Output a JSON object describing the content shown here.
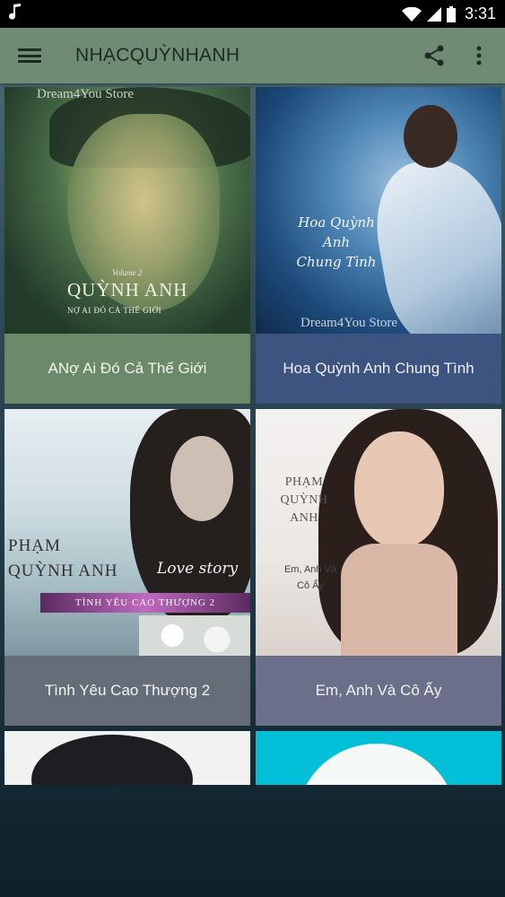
{
  "status_bar": {
    "left_icon": "music-note-icon",
    "time": "3:31"
  },
  "app_bar": {
    "title": "NHẠCQUỲNHANH",
    "menu_icon": "hamburger-menu-icon",
    "share_icon": "share-icon",
    "more_icon": "more-vert-icon",
    "color": "#6f8b73"
  },
  "albums": [
    {
      "caption": "ANợ Ai Đó Cả Thế Giới",
      "art": {
        "watermark": "Dream4You Store",
        "volume": "Volume 2",
        "title": "QUỲNH ANH",
        "subtitle": "NỢ AI ĐÓ CẢ THẾ GIỚI"
      },
      "caption_color": "#6c8a69"
    },
    {
      "caption": "Hoa Quỳnh Anh Chung Tình",
      "art": {
        "script_line1": "Hoa Quỳnh Anh",
        "script_line2": "Chung Tình",
        "watermark": "Dream4You Store"
      },
      "caption_color": "#3d5480"
    },
    {
      "caption": "Tình Yêu Cao Thượng 2",
      "art": {
        "name_line1": "PHẠM",
        "name_line2": "QUỲNH ANH",
        "script": "Love story",
        "band": "TÌNH YÊU CAO THƯỢNG 2"
      },
      "caption_color": "#656d78"
    },
    {
      "caption": "Em, Anh Và Cô Ấy",
      "art": {
        "name_line1": "PHẠM",
        "name_line2": "QUỲNH",
        "name_line3": "ANH",
        "sub_line1": "Em, Anh Và",
        "sub_line2": "Cô Ấy"
      },
      "caption_color": "#6c6f8a"
    }
  ]
}
